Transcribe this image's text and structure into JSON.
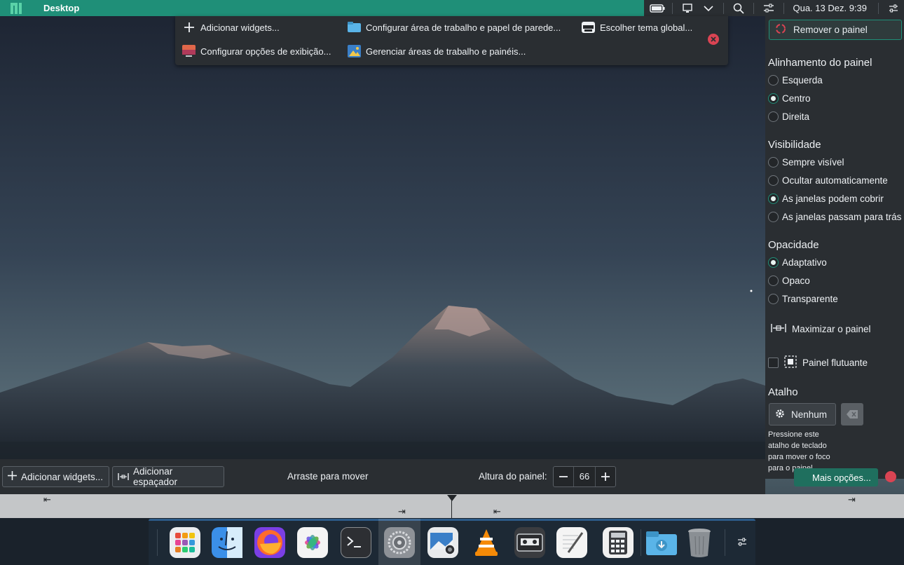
{
  "topbar": {
    "title": "Desktop",
    "clock": "Qua. 13 Dez. 9:39"
  },
  "context_toolbar": {
    "items": [
      {
        "label": "Adicionar widgets...",
        "icon": "plus-icon"
      },
      {
        "label": "Configurar área de trabalho e papel de parede...",
        "icon": "folder-icon"
      },
      {
        "label": "Escolher tema global...",
        "icon": "theme-mask-icon"
      },
      {
        "label": "Configurar opções de exibição...",
        "icon": "display-icon"
      },
      {
        "label": "Gerenciar áreas de trabalho e painéis...",
        "icon": "desktops-icon"
      }
    ]
  },
  "panel_settings": {
    "remove_label": "Remover o painel",
    "alignment": {
      "heading": "Alinhamento do painel",
      "options": [
        "Esquerda",
        "Centro",
        "Direita"
      ],
      "selected": "Centro"
    },
    "visibility": {
      "heading": "Visibilidade",
      "options": [
        "Sempre visível",
        "Ocultar automaticamente",
        "As janelas podem cobrir",
        "As janelas passam para trás"
      ],
      "selected": "As janelas podem cobrir"
    },
    "opacity": {
      "heading": "Opacidade",
      "options": [
        "Adaptativo",
        "Opaco",
        "Transparente"
      ],
      "selected": "Adaptativo"
    },
    "maximize_label": "Maximizar o painel",
    "floating_label": "Painel flutuante",
    "floating_checked": false,
    "shortcut": {
      "heading": "Atalho",
      "button_label": "Nenhum",
      "help_lines": [
        "Pressione este",
        "atalho de teclado",
        "para mover o foco",
        "para o painel"
      ]
    }
  },
  "edit_bar": {
    "add_widgets": "Adicionar widgets...",
    "add_spacer": "Adicionar espaçador",
    "drag_hint": "Arraste para mover",
    "height_label": "Altura do painel:",
    "height_value": "66",
    "more_options": "Mais opções..."
  },
  "dock": {
    "items": [
      "app-launcher",
      "finder",
      "firefox",
      "photos",
      "terminal",
      "system-settings",
      "screenshot",
      "vlc",
      "tape-recorder",
      "text-editor",
      "calculator",
      "downloads-folder",
      "trash"
    ],
    "active": "system-settings"
  },
  "colors": {
    "accent": "#1f8f78",
    "panel_bg": "#2a2e32",
    "close_red": "#da4453"
  }
}
